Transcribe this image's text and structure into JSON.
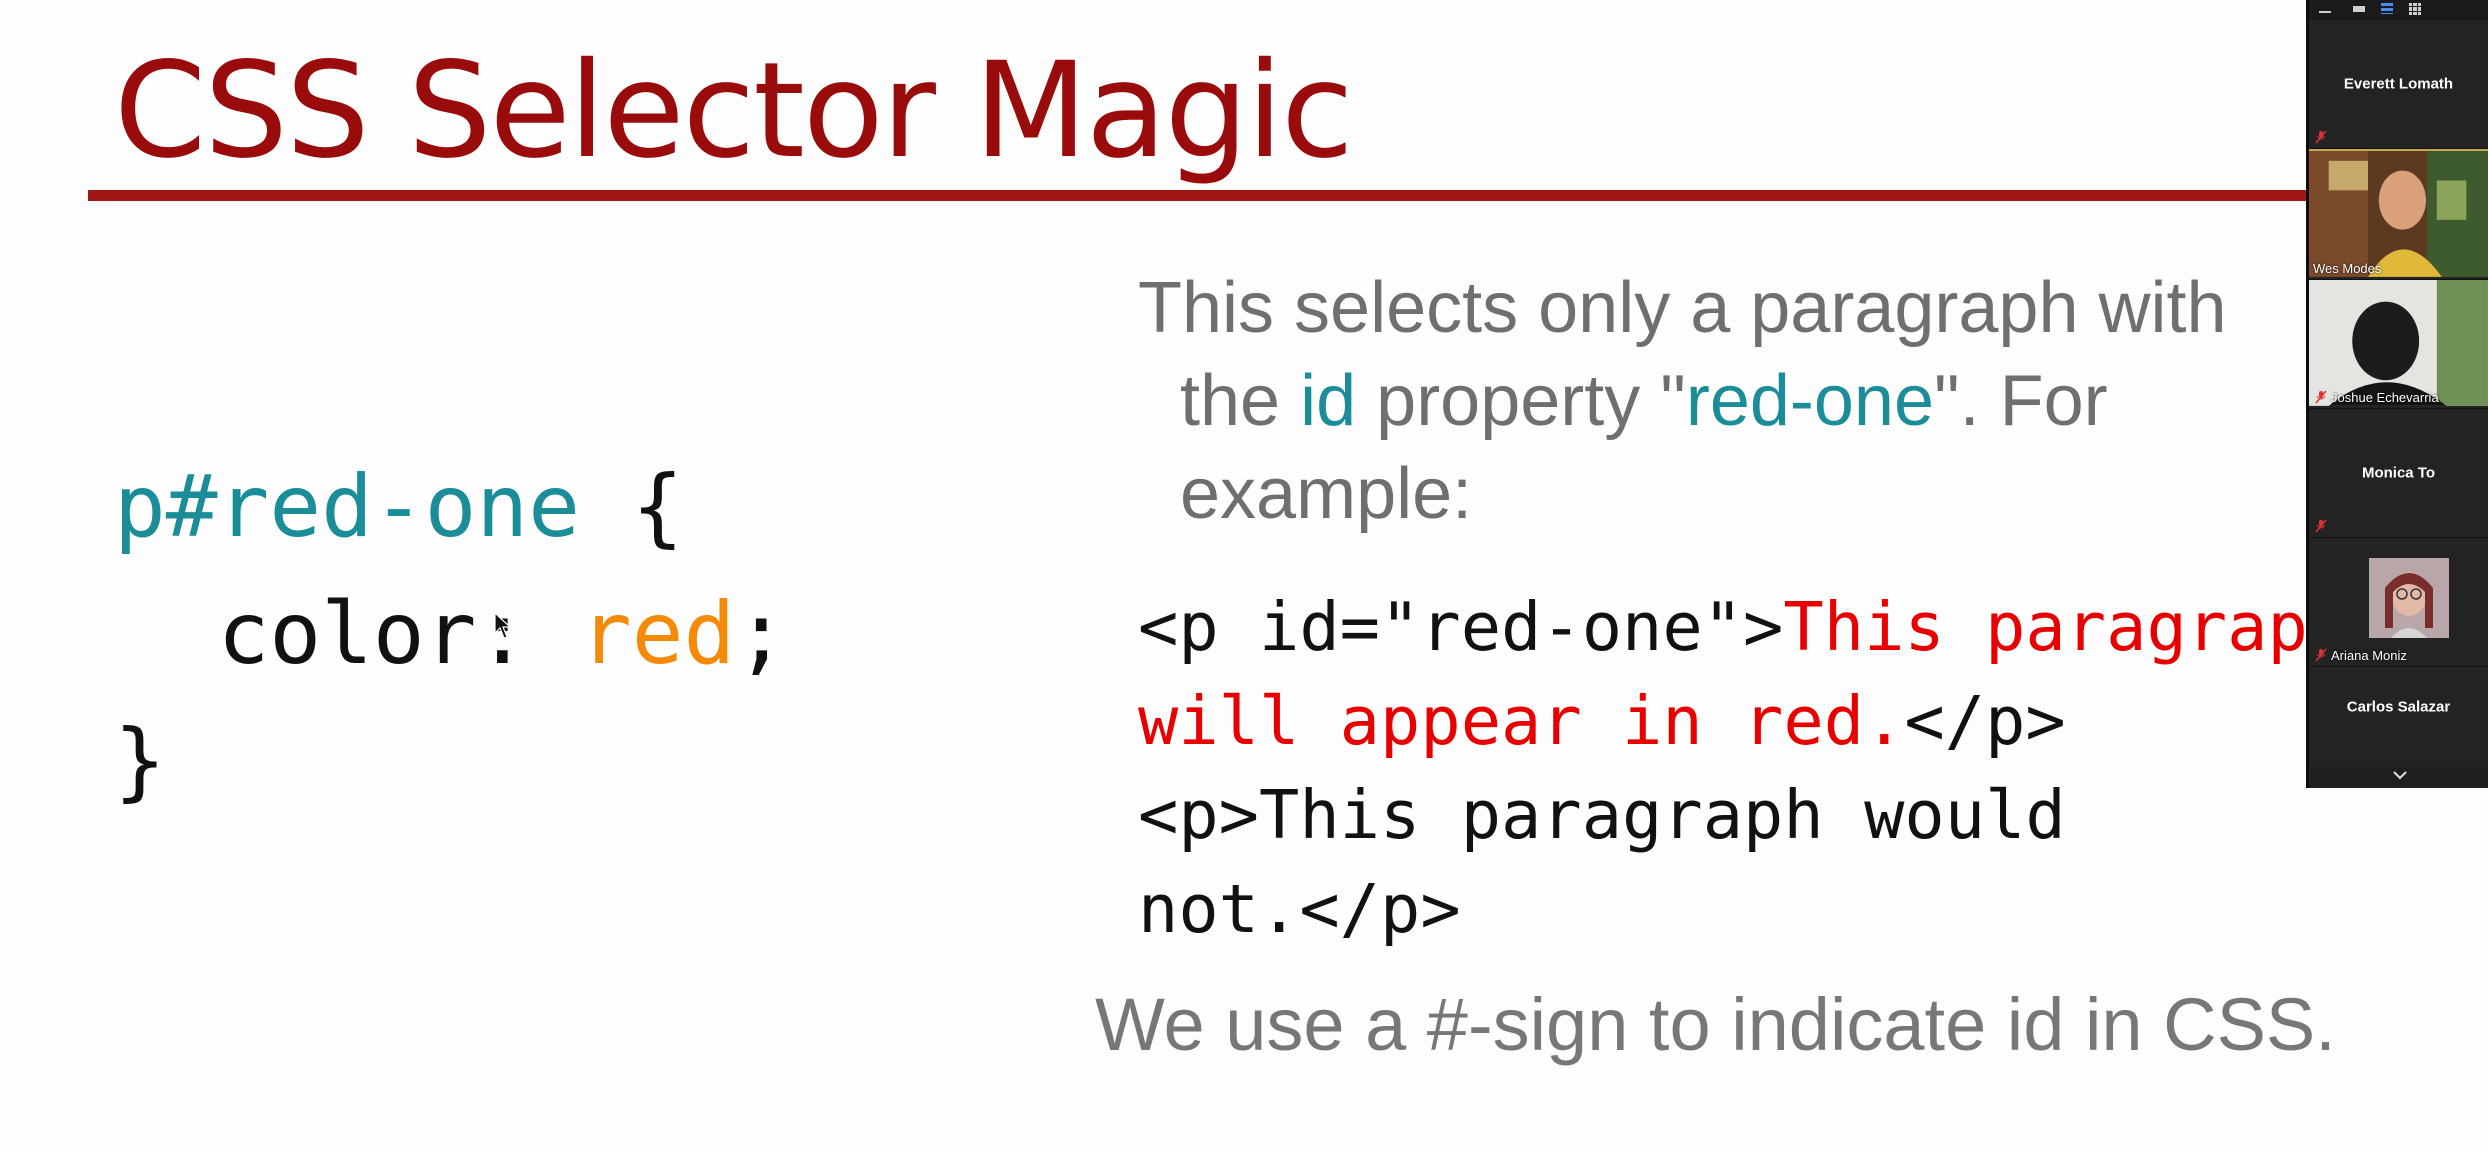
{
  "slide": {
    "title": "CSS Selector Magic",
    "code": {
      "line1_selector": "p#red-one",
      "line1_brace": " {",
      "line2_indent": "  ",
      "line2_property": "color: ",
      "line2_value": "red",
      "line2_semicolon": ";",
      "line3_brace": "}"
    },
    "explanation": {
      "part1": "This selects only a paragraph with",
      "part2a": "the ",
      "part2_id": "id",
      "part2b": " property \"",
      "part2_value": "red-one",
      "part2c": "\". For",
      "part3": "example:"
    },
    "html_example": {
      "line1_tag": "<p id=\"red-one\">",
      "line1_red": "This paragraph",
      "line2_red": "will appear in red.",
      "line2_tag": "</p>",
      "line3": "<p>This paragraph would",
      "line4": "not.</p>"
    },
    "footer_note": "We use a #-sign to indicate id in CSS."
  },
  "participants": [
    {
      "name": "Everett Lomath",
      "video": false,
      "muted": true
    },
    {
      "name": "Wes Modes",
      "video": true,
      "muted": false
    },
    {
      "name": "Joshue Echevarria",
      "video": true,
      "muted": true
    },
    {
      "name": "Monica To",
      "video": false,
      "muted": true
    },
    {
      "name": "Ariana Moniz",
      "video": false,
      "avatar": true,
      "muted": true
    },
    {
      "name": "Carlos Salazar",
      "video": false,
      "muted": false
    }
  ],
  "colors": {
    "title": "#9a0c0c",
    "code_selector": "#1a8d99",
    "code_value": "#f58a08",
    "example_red": "#e80000"
  }
}
